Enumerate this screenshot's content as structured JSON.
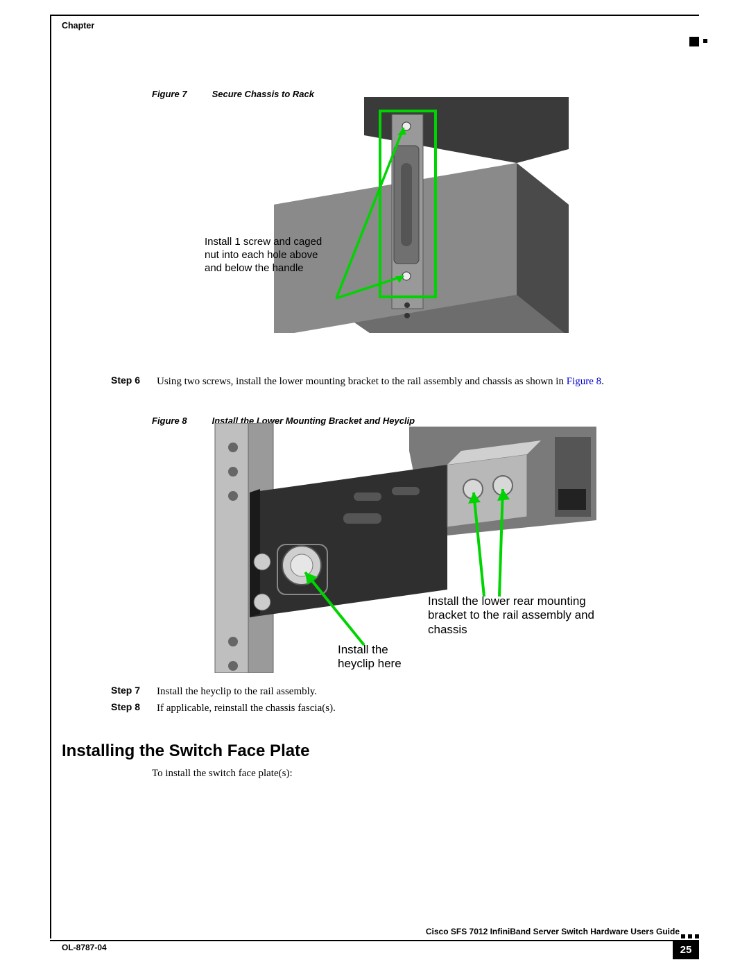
{
  "header": {
    "chapter_label": "Chapter"
  },
  "figure7": {
    "label_prefix": "Figure 7",
    "caption": "Secure Chassis to Rack",
    "annotation": "Install 1 screw and caged nut into  each hole above and below the handle"
  },
  "steps": {
    "step6": {
      "label": "Step 6",
      "text_part1": "Using two screws, install the lower mounting bracket to the rail assembly and chassis as shown in ",
      "link": "Figure 8",
      "text_part2": "."
    },
    "step7": {
      "label": "Step 7",
      "text": "Install the heyclip to the rail assembly."
    },
    "step8": {
      "label": "Step 8",
      "text": "If applicable, reinstall the chassis fascia(s)."
    }
  },
  "figure8": {
    "label_prefix": "Figure 8",
    "caption": "Install the Lower Mounting Bracket and Heyclip",
    "annotation_left": "Install the\nheyclip  here",
    "annotation_right": "Install the lower rear mounting bracket to the rail assembly and chassis"
  },
  "section": {
    "heading": "Installing the Switch Face Plate",
    "body": "To install the switch face plate(s):"
  },
  "footer": {
    "title": "Cisco SFS 7012 InfiniBand Server Switch Hardware Users Guide",
    "docnum": "OL-8787-04",
    "page": "25"
  }
}
